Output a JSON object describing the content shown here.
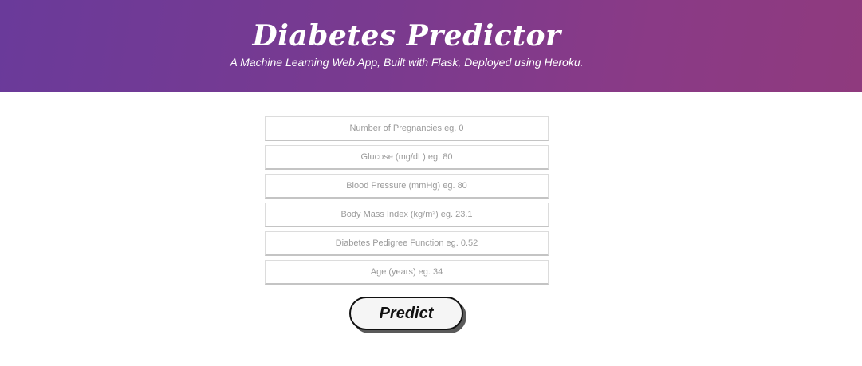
{
  "header": {
    "title": "Diabetes Predictor",
    "subtitle": "A Machine Learning Web App, Built with Flask, Deployed using Heroku.",
    "gradient_colors": [
      "#6a3a9a",
      "#8f3a7e"
    ]
  },
  "form": {
    "fields": [
      {
        "placeholder": "Number of Pregnancies eg. 0",
        "value": ""
      },
      {
        "placeholder": "Glucose (mg/dL) eg. 80",
        "value": ""
      },
      {
        "placeholder": "Blood Pressure (mmHg) eg. 80",
        "value": ""
      },
      {
        "placeholder": "Body Mass Index (kg/m²) eg. 23.1",
        "value": ""
      },
      {
        "placeholder": "Diabetes Pedigree Function eg. 0.52",
        "value": ""
      },
      {
        "placeholder": "Age (years) eg. 34",
        "value": ""
      }
    ],
    "submit_label": "Predict"
  }
}
